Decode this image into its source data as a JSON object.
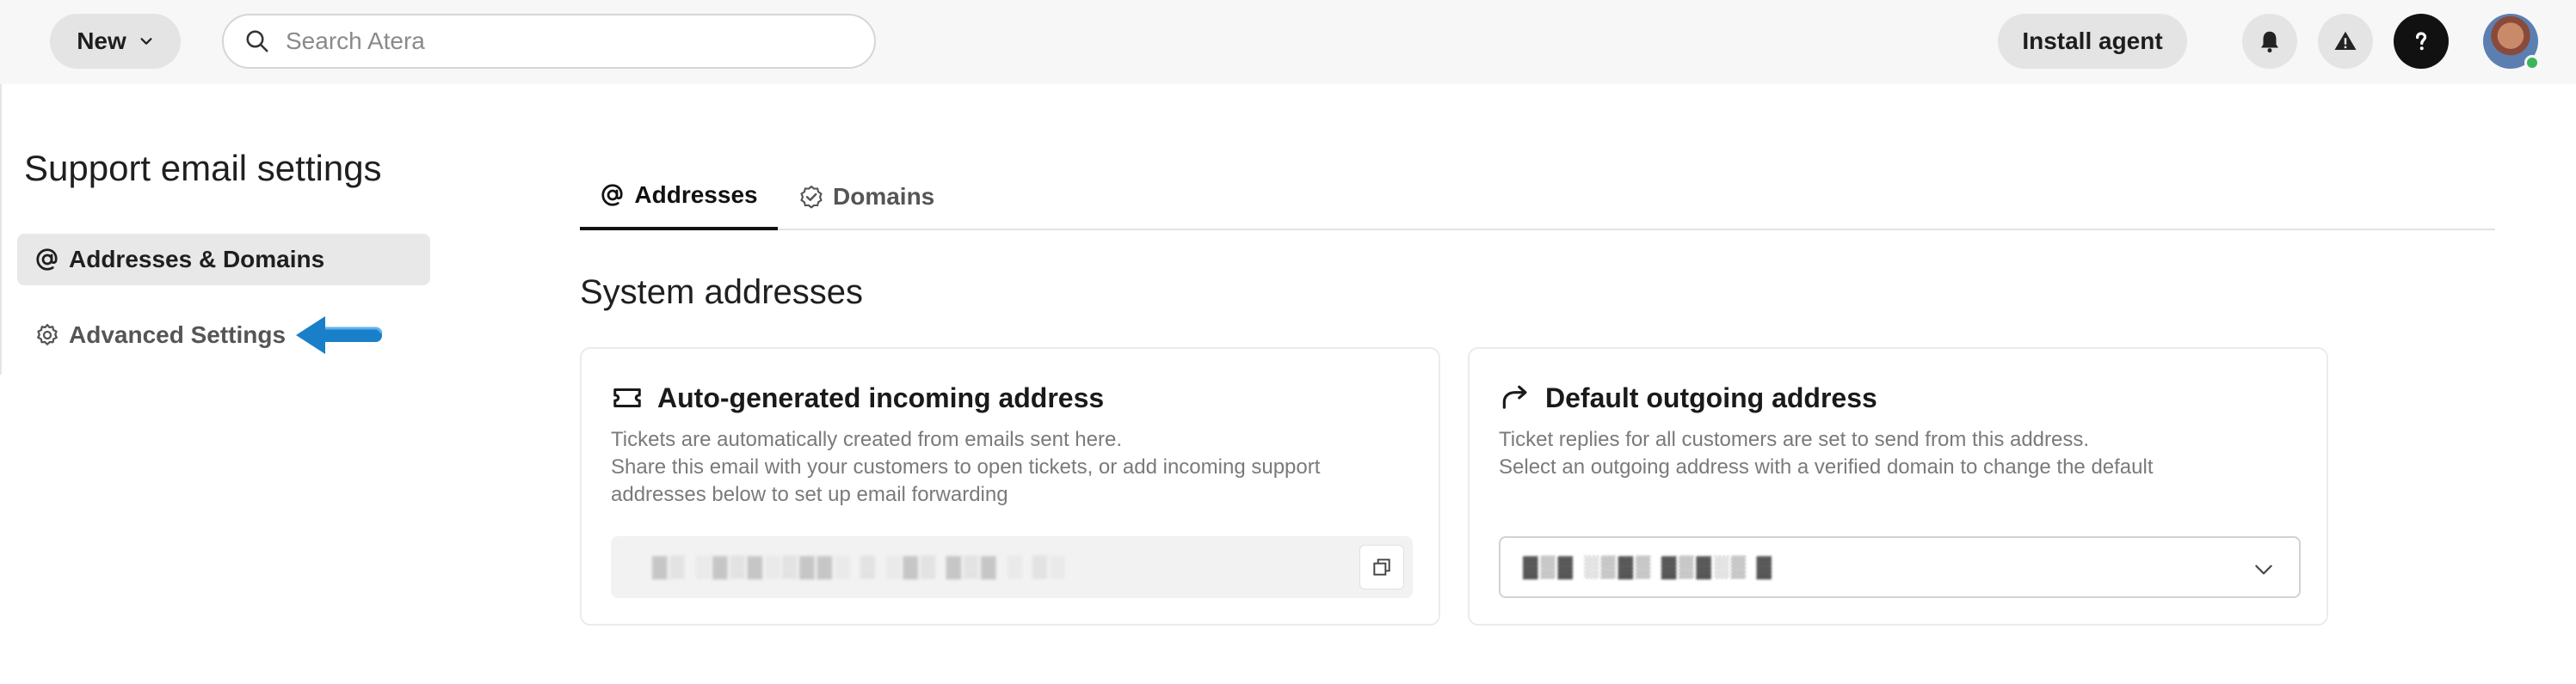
{
  "topbar": {
    "new_label": "New",
    "search_placeholder": "Search Atera",
    "install_label": "Install agent",
    "icons": [
      "bell-icon",
      "warning-icon",
      "help-icon",
      "avatar"
    ]
  },
  "sidebar": {
    "title": "Support email settings",
    "items": [
      {
        "label": "Addresses & Domains",
        "icon": "at-icon",
        "active": true
      },
      {
        "label": "Advanced Settings",
        "icon": "gear-icon",
        "active": false
      }
    ]
  },
  "tabs": [
    {
      "label": "Addresses",
      "icon": "at-icon",
      "active": true
    },
    {
      "label": "Domains",
      "icon": "verified-badge-icon",
      "active": false
    }
  ],
  "section_title": "System addresses",
  "cards": {
    "incoming": {
      "title": "Auto-generated incoming address",
      "icon": "ticket-icon",
      "desc_lines": [
        "Tickets are automatically created from emails sent here.",
        "Share this email with your customers to open tickets, or add incoming support",
        "addresses below to set up email forwarding"
      ],
      "address_value": "▓▒ ░▓▒▓░▒▓▓░ ▒ ░▓▒ ▓▒▓ ░ ▒░"
    },
    "outgoing": {
      "title": "Default outgoing address",
      "icon": "forward-arrow-icon",
      "desc_lines": [
        "Ticket replies for all customers are set to send from this address.",
        "Select an outgoing address with a verified domain to change the default"
      ],
      "selected_value": "▓▒▓ ░▒▓▒ ▓▒▓░▒ ▓"
    }
  },
  "colors": {
    "annotation_arrow": "#1a7fc9",
    "topbar_bg": "#f7f7f7",
    "pill_bg": "#e4e4e4",
    "online": "#3cb55a"
  }
}
